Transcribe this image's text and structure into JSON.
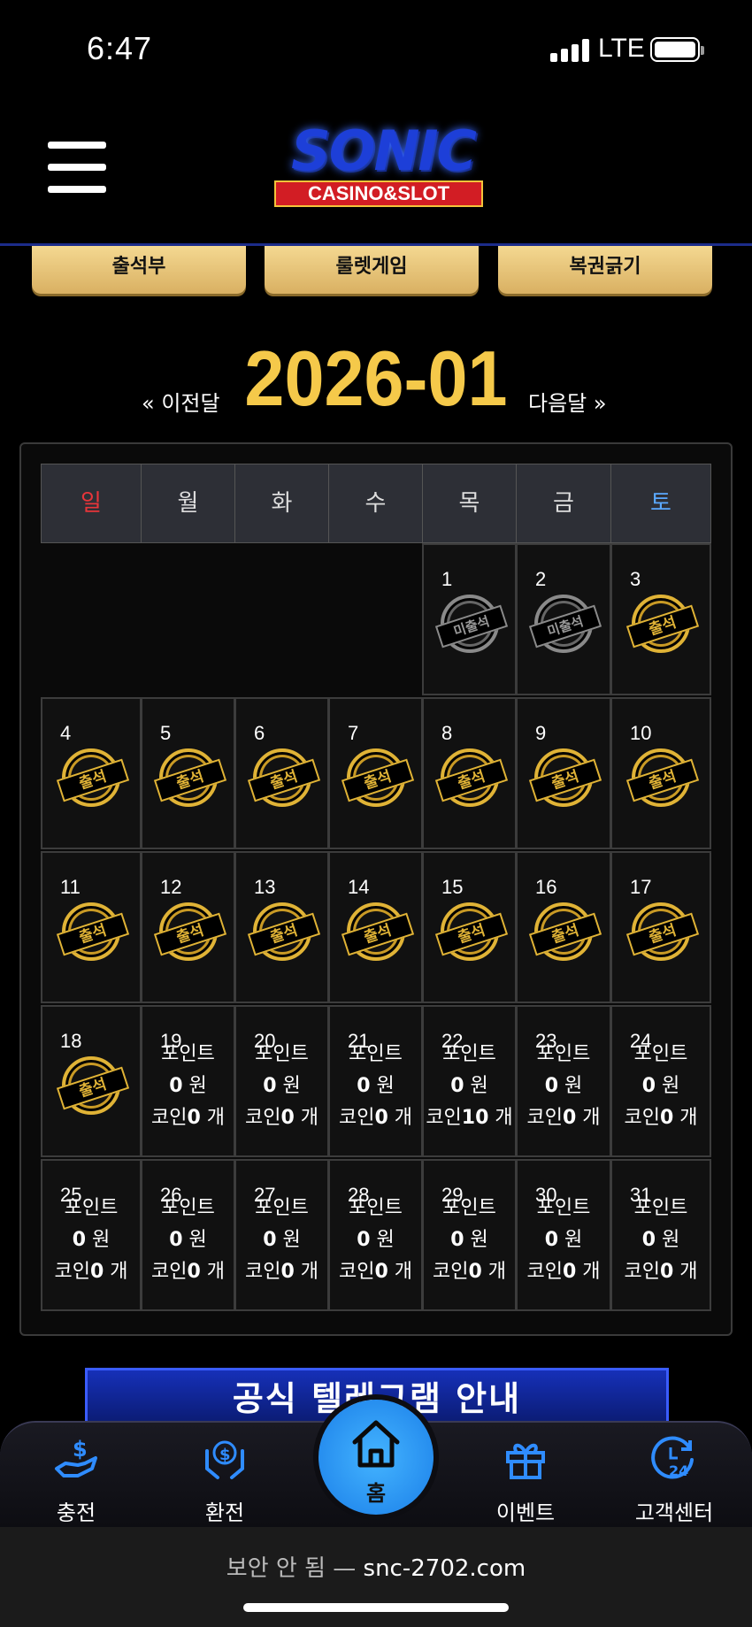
{
  "status_bar": {
    "time": "6:47",
    "network": "LTE"
  },
  "top_buttons": [
    {
      "label": "출석부"
    },
    {
      "label": "룰렛게임"
    },
    {
      "label": "복권긁기"
    }
  ],
  "calendar": {
    "title": "2026-01",
    "prev_label": "« 이전달",
    "next_label": "다음달 »",
    "weekdays": [
      "일",
      "월",
      "화",
      "수",
      "목",
      "금",
      "토"
    ],
    "weekday_colors": {
      "sun": "#e8353a",
      "sat": "#5aa8ff",
      "default": "#dddddd"
    },
    "stamp_present_label": "출석",
    "stamp_absent_label": "미출석",
    "days": [
      {
        "day": "1",
        "status": "absent"
      },
      {
        "day": "2",
        "status": "absent"
      },
      {
        "day": "3",
        "status": "present"
      },
      {
        "day": "4",
        "status": "present"
      },
      {
        "day": "5",
        "status": "present"
      },
      {
        "day": "6",
        "status": "present"
      },
      {
        "day": "7",
        "status": "present"
      },
      {
        "day": "8",
        "status": "present"
      },
      {
        "day": "9",
        "status": "present"
      },
      {
        "day": "10",
        "status": "present"
      },
      {
        "day": "11",
        "status": "present"
      },
      {
        "day": "12",
        "status": "present"
      },
      {
        "day": "13",
        "status": "present"
      },
      {
        "day": "14",
        "status": "present"
      },
      {
        "day": "15",
        "status": "present"
      },
      {
        "day": "16",
        "status": "present"
      },
      {
        "day": "17",
        "status": "present"
      },
      {
        "day": "18",
        "status": "present"
      },
      {
        "day": "19",
        "status": "future",
        "point": "0",
        "coin": "0"
      },
      {
        "day": "20",
        "status": "future",
        "point": "0",
        "coin": "0"
      },
      {
        "day": "21",
        "status": "future",
        "point": "0",
        "coin": "0"
      },
      {
        "day": "22",
        "status": "future",
        "point": "0",
        "coin": "10"
      },
      {
        "day": "23",
        "status": "future",
        "point": "0",
        "coin": "0"
      },
      {
        "day": "24",
        "status": "future",
        "point": "0",
        "coin": "0"
      },
      {
        "day": "25",
        "status": "future",
        "point": "0",
        "coin": "0"
      },
      {
        "day": "26",
        "status": "future",
        "point": "0",
        "coin": "0"
      },
      {
        "day": "27",
        "status": "future",
        "point": "0",
        "coin": "0"
      },
      {
        "day": "28",
        "status": "future",
        "point": "0",
        "coin": "0"
      },
      {
        "day": "29",
        "status": "future",
        "point": "0",
        "coin": "0"
      },
      {
        "day": "30",
        "status": "future",
        "point": "0",
        "coin": "0"
      },
      {
        "day": "31",
        "status": "future",
        "point": "0",
        "coin": "0"
      }
    ],
    "point_label": "포인트",
    "won_unit": "원",
    "coin_label": "코인",
    "count_unit": "개"
  },
  "banner": {
    "text": "공식 텔레그램 안내"
  },
  "bottom_nav": [
    {
      "label": "충전",
      "icon": "deposit-icon"
    },
    {
      "label": "환전",
      "icon": "withdraw-icon"
    },
    {
      "label": "홈",
      "icon": "home-icon"
    },
    {
      "label": "이벤트",
      "icon": "gift-icon"
    },
    {
      "label": "고객센터",
      "icon": "support-24-icon"
    }
  ],
  "url_bar": {
    "prefix": "보안 안 됨 —",
    "domain": "snc-2702.com"
  },
  "colors": {
    "gold": "#f5c94a",
    "accent_blue": "#1a7ee8",
    "background": "#000000"
  }
}
